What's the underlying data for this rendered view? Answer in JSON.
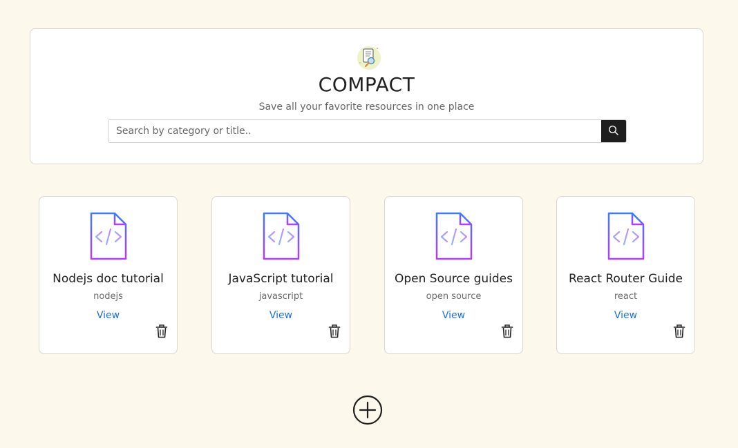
{
  "header": {
    "title": "COMPACT",
    "subtitle": "Save all your favorite resources in one place",
    "logo_icon": "document-search-icon"
  },
  "search": {
    "placeholder": "Search by category or title..",
    "value": "",
    "button_icon": "search-icon"
  },
  "cards": [
    {
      "title": "Nodejs doc tutorial",
      "category": "nodejs",
      "view_label": "View",
      "icon": "code-file-icon",
      "delete_icon": "trash-icon"
    },
    {
      "title": "JavaScript tutorial",
      "category": "javascript",
      "view_label": "View",
      "icon": "code-file-icon",
      "delete_icon": "trash-icon"
    },
    {
      "title": "Open Source guides",
      "category": "open source",
      "view_label": "View",
      "icon": "code-file-icon",
      "delete_icon": "trash-icon"
    },
    {
      "title": "React Router Guide",
      "category": "react",
      "view_label": "View",
      "icon": "code-file-icon",
      "delete_icon": "trash-icon"
    }
  ],
  "add_button": {
    "icon": "plus-circle-icon"
  },
  "colors": {
    "background": "#fdf8ec",
    "link": "#1a6fe0",
    "icon_gradient_start": "#3b7bff",
    "icon_gradient_end": "#b43bff",
    "search_button": "#1e1e1e"
  }
}
